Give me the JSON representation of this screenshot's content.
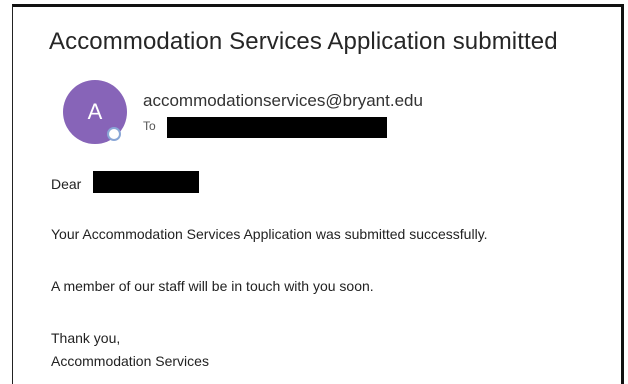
{
  "email": {
    "subject": "Accommodation Services Application submitted",
    "sender": {
      "avatar_initial": "A",
      "avatar_color": "#8764b8",
      "address": "accommodationservices@bryant.edu"
    },
    "to_label": "To",
    "greeting": "Dear",
    "body_lines": [
      "Your Accommodation Services Application was submitted successfully.",
      "A member of our staff will be in touch with you soon."
    ],
    "closing": [
      "Thank you,",
      "Accommodation Services"
    ]
  }
}
